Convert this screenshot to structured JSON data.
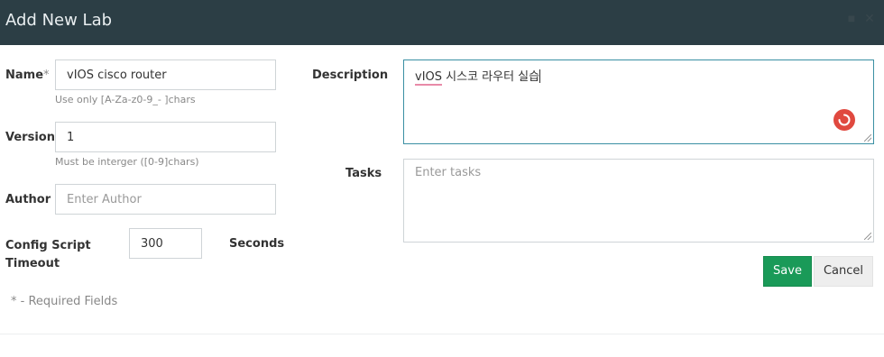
{
  "dialog": {
    "title": "Add New Lab"
  },
  "form": {
    "name": {
      "label": "Name",
      "required_mark": "*",
      "value": "vIOS cisco router",
      "hint": "Use only [A-Za-z0-9_- ]chars"
    },
    "version": {
      "label": "Version",
      "required_mark": "*",
      "value": "1",
      "hint": "Must be interger ([0-9]chars)"
    },
    "author": {
      "label": "Author",
      "placeholder": "Enter Author"
    },
    "config_timeout": {
      "label_line1": "Config Script",
      "label_line2": "Timeout",
      "value": "300",
      "unit": "Seconds"
    },
    "description": {
      "label": "Description",
      "value_prefix": "vIOS",
      "value_rest": " 시스코 라우터 실습"
    },
    "tasks": {
      "label": "Tasks",
      "placeholder": "Enter tasks"
    },
    "required_note": "* - Required Fields"
  },
  "buttons": {
    "save": "Save",
    "cancel": "Cancel"
  },
  "colors": {
    "header_bg": "#2c3e45",
    "save_bg": "#1a9a58",
    "focus_border": "#3a8fa3",
    "spell_underline": "#e88ba8",
    "grammar_badge": "#e0493f"
  },
  "icons": {
    "window_controls": [
      "minimize-icon",
      "close-icon"
    ],
    "grammar_check": "loading-spinner-icon"
  }
}
